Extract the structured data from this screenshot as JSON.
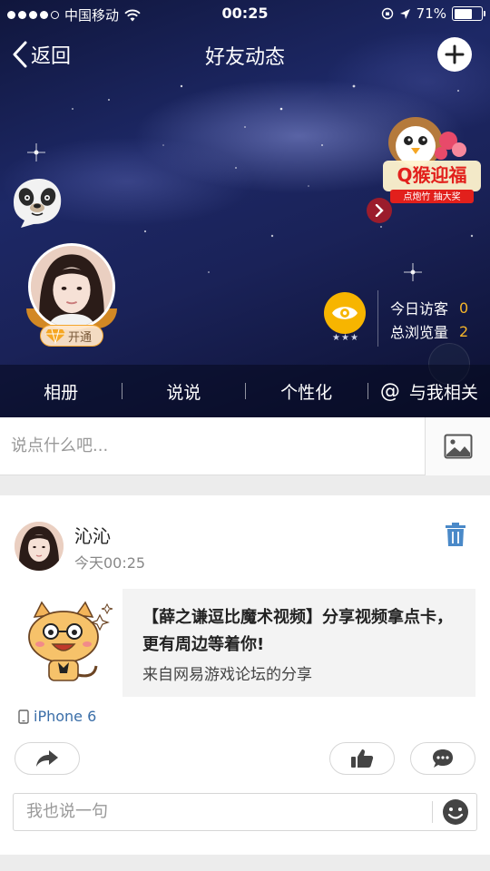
{
  "status_bar": {
    "carrier": "中国移动",
    "time": "00:25",
    "battery": "71%",
    "battery_level": 0.71
  },
  "nav": {
    "back_label": "返回",
    "title": "好友动态"
  },
  "profile": {
    "vip_label": "开通",
    "visitor_rating": "★★★",
    "stats": [
      {
        "label": "今日访客",
        "value": "0"
      },
      {
        "label": "总浏览量",
        "value": "2"
      }
    ]
  },
  "tabs": [
    "相册",
    "说说",
    "个性化",
    "与我相关"
  ],
  "compose": {
    "placeholder": "说点什么吧..."
  },
  "post": {
    "user_name": "沁沁",
    "time": "今天00:25",
    "share_title": "【薛之谦逗比魔术视频】分享视频拿点卡，更有周边等着你!",
    "share_source": "来自网易游戏论坛的分享",
    "device": "iPhone 6",
    "comment_placeholder": "我也说一句"
  },
  "colors": {
    "accent_orange": "#f5b52a",
    "link_blue": "#3a6ea8",
    "delete_blue": "#4a89c8"
  }
}
